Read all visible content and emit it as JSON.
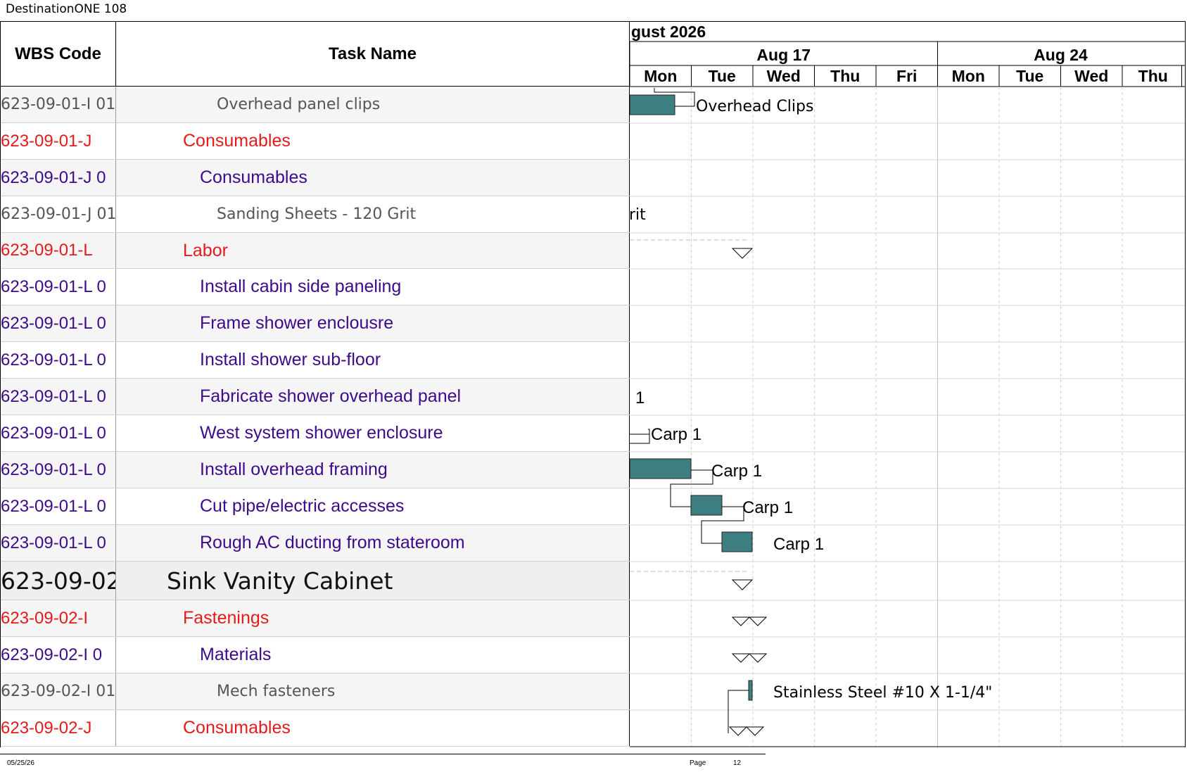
{
  "document": {
    "title": "DestinationONE 108"
  },
  "table": {
    "columns": {
      "wbs": "WBS Code",
      "task": "Task Name"
    },
    "rows": [
      {
        "wbs": "623-09-01-I 01",
        "task": "Overhead panel clips",
        "level": "gray",
        "bar_text": "Overhead Clips"
      },
      {
        "wbs": "623-09-01-J",
        "task": "Consumables",
        "level": "red",
        "bar_text": ""
      },
      {
        "wbs": "623-09-01-J 0",
        "task": "Consumables",
        "level": "purple",
        "bar_text": ""
      },
      {
        "wbs": "623-09-01-J 01",
        "task": "Sanding Sheets - 120 Grit",
        "level": "gray",
        "bar_text": "rit"
      },
      {
        "wbs": "623-09-01-L",
        "task": "Labor",
        "level": "red",
        "bar_text": ""
      },
      {
        "wbs": "623-09-01-L 0",
        "task": "Install cabin side paneling",
        "level": "purple",
        "bar_text": ""
      },
      {
        "wbs": "623-09-01-L 0",
        "task": "Frame shower enclousre",
        "level": "purple",
        "bar_text": ""
      },
      {
        "wbs": "623-09-01-L 0",
        "task": "Install shower sub-floor",
        "level": "purple",
        "bar_text": ""
      },
      {
        "wbs": "623-09-01-L 0",
        "task": "Fabricate shower overhead panel",
        "level": "purple",
        "bar_text": "1"
      },
      {
        "wbs": "623-09-01-L 0",
        "task": "West system shower enclosure",
        "level": "purple",
        "bar_text": "Carp 1"
      },
      {
        "wbs": "623-09-01-L 0",
        "task": "Install overhead framing",
        "level": "purple",
        "bar_text": "Carp 1"
      },
      {
        "wbs": "623-09-01-L 0",
        "task": "Cut pipe/electric accesses",
        "level": "purple",
        "bar_text": "Carp 1"
      },
      {
        "wbs": "623-09-01-L 0",
        "task": "Rough AC ducting from stateroom",
        "level": "purple",
        "bar_text": "Carp 1"
      },
      {
        "wbs": "623-09-02",
        "task": "Sink Vanity Cabinet",
        "level": "black",
        "bar_text": ""
      },
      {
        "wbs": "623-09-02-I",
        "task": "Fastenings",
        "level": "red",
        "bar_text": ""
      },
      {
        "wbs": "623-09-02-I 0",
        "task": "Materials",
        "level": "purple",
        "bar_text": ""
      },
      {
        "wbs": "623-09-02-I 01",
        "task": "Mech fasteners",
        "level": "gray",
        "bar_text": "Stainless Steel #10 X 1-1/4\""
      },
      {
        "wbs": "623-09-02-J",
        "task": "Consumables",
        "level": "red",
        "bar_text": ""
      }
    ]
  },
  "timescale": {
    "month": "gust 2026",
    "weeks": [
      "Aug 17",
      "Aug 24"
    ],
    "days": [
      "Mon",
      "Tue",
      "Wed",
      "Thu",
      "Fri",
      "Mon",
      "Tue",
      "Wed",
      "Thu"
    ]
  },
  "colors": {
    "bar_fill": "#3d7f80",
    "red": "#e31b1b",
    "purple": "#3d0a8c",
    "gray": "#555555"
  },
  "footer": {
    "date": "05/25/26",
    "page_label": "Page",
    "page_number": "12"
  }
}
